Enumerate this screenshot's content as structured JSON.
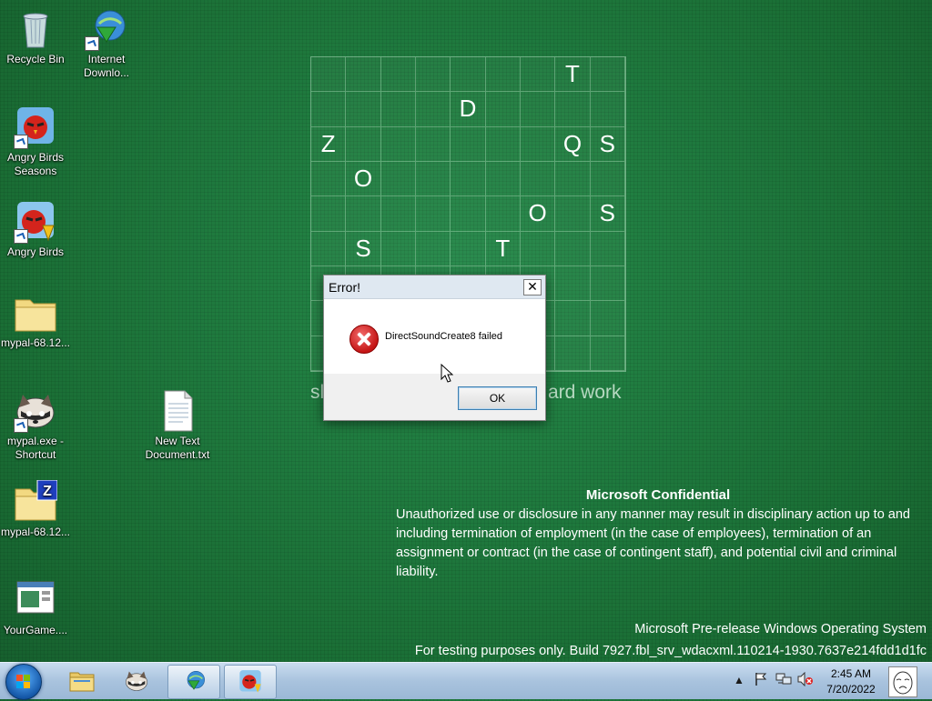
{
  "desktop": {
    "icons": [
      {
        "label": "Recycle Bin",
        "icon": "recycle-bin-icon"
      },
      {
        "label": "Internet Downlo...",
        "icon": "download-manager-icon"
      },
      {
        "label": "Angry Birds Seasons",
        "icon": "angry-birds-seasons-icon"
      },
      {
        "label": "Angry Birds",
        "icon": "angry-birds-icon"
      },
      {
        "label": "mypal-68.12...",
        "icon": "folder-icon"
      },
      {
        "label": "mypal.exe - Shortcut",
        "icon": "raccoon-icon"
      },
      {
        "label": "New Text Document.txt",
        "icon": "text-file-icon"
      },
      {
        "label": "mypal-68.12...",
        "icon": "zip-folder-icon"
      },
      {
        "label": "YourGame....",
        "icon": "game-icon"
      }
    ]
  },
  "grid": {
    "letters": [
      {
        "row": 0,
        "col": 7,
        "char": "T"
      },
      {
        "row": 1,
        "col": 4,
        "char": "D"
      },
      {
        "row": 2,
        "col": 0,
        "char": "Z"
      },
      {
        "row": 2,
        "col": 7,
        "char": "Q"
      },
      {
        "row": 2,
        "col": 8,
        "char": "S"
      },
      {
        "row": 3,
        "col": 1,
        "char": "O"
      },
      {
        "row": 4,
        "col": 6,
        "char": "O"
      },
      {
        "row": 4,
        "col": 8,
        "char": "S"
      },
      {
        "row": 5,
        "col": 1,
        "char": "S"
      },
      {
        "row": 5,
        "col": 5,
        "char": "T"
      }
    ],
    "tagline_left": "sl",
    "tagline_right": "ard work"
  },
  "confidential": {
    "title": "Microsoft Confidential",
    "body": "Unauthorized use or disclosure in any manner may result in disciplinary action up to and including termination of employment (in the case of employees), termination of an assignment or contract (in the case of contingent staff), and potential civil and criminal liability."
  },
  "watermark": {
    "line1": "Microsoft Pre-release Windows Operating System",
    "line2": "For testing purposes only. Build 7927.fbl_srv_wdacxml.110214-1930.7637e214fdd1d1fc"
  },
  "dialog": {
    "title": "Error!",
    "close_label": "✕",
    "message": "DirectSoundCreate8 failed",
    "ok_label": "OK"
  },
  "taskbar": {
    "pinned": [
      "explorer-icon",
      "raccoon-icon",
      "download-manager-icon",
      "angry-birds-icon"
    ],
    "clock_time": "2:45 AM",
    "clock_date": "7/20/2022"
  },
  "colors": {
    "desktop_green": "#1f7a3c",
    "error_red": "#c51616"
  }
}
